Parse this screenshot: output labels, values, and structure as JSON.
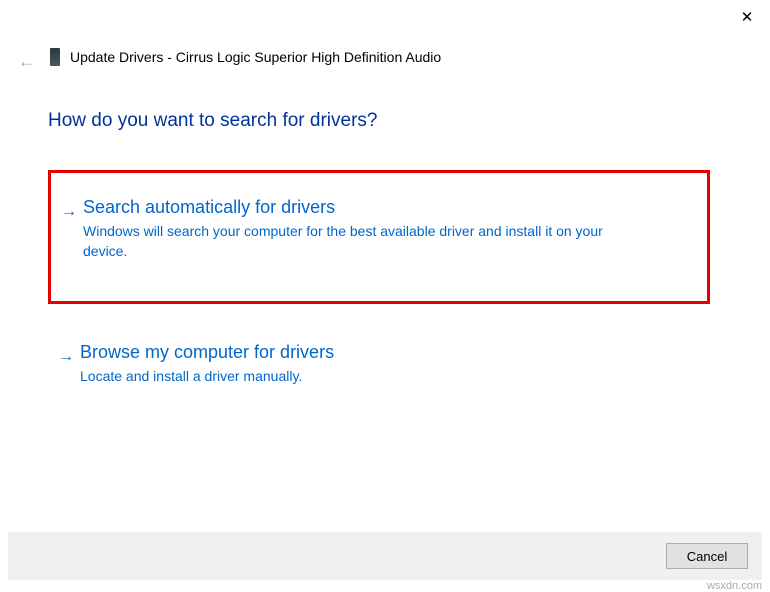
{
  "window": {
    "title": "Update Drivers - Cirrus Logic Superior High Definition Audio"
  },
  "heading": "How do you want to search for drivers?",
  "options": [
    {
      "title": "Search automatically for drivers",
      "description": "Windows will search your computer for the best available driver and install it on your device."
    },
    {
      "title": "Browse my computer for drivers",
      "description": "Locate and install a driver manually."
    }
  ],
  "buttons": {
    "cancel": "Cancel"
  },
  "watermark": "wsxdn.com"
}
